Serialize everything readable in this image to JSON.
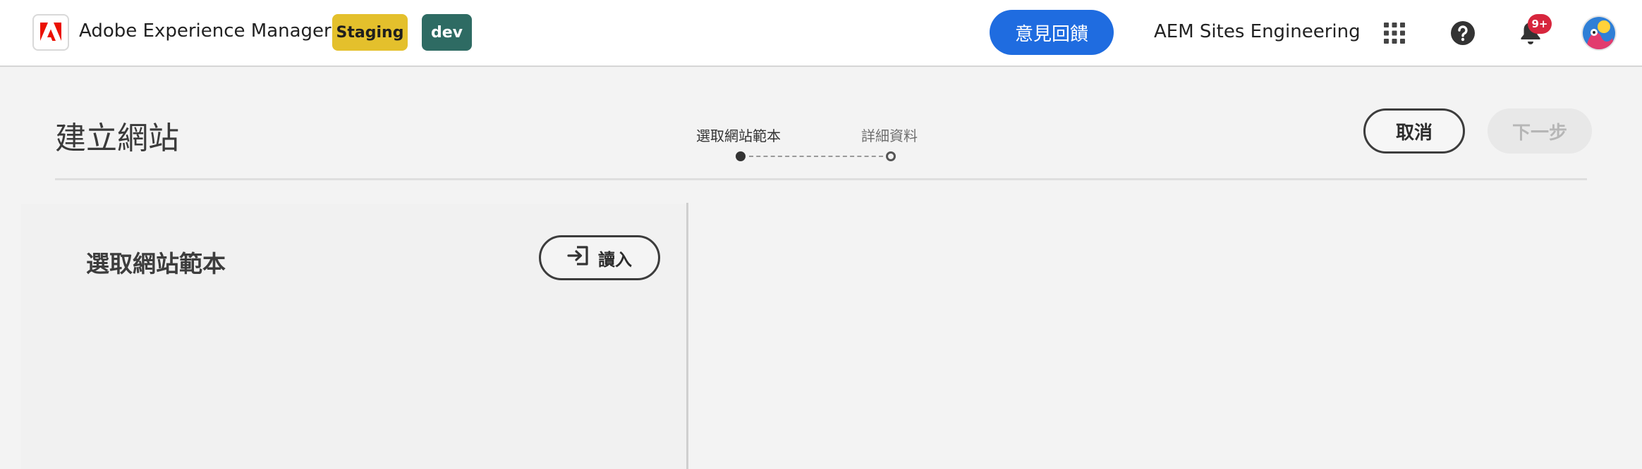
{
  "header": {
    "app_title": "Adobe Experience Manager",
    "logo_icon": "adobe-logo-icon",
    "env_badges": [
      {
        "label": "Staging",
        "color": "#e4c02c"
      },
      {
        "label": "dev",
        "color": "#2e6b63"
      }
    ],
    "feedback_label": "意見回饋",
    "org_name": "AEM Sites Engineering",
    "icons": [
      "apps-grid-icon",
      "help-icon",
      "bell-icon",
      "avatar"
    ],
    "notification_count": "9+",
    "accent_color": "#1f6ce0"
  },
  "wizard": {
    "title": "建立網站",
    "steps": [
      {
        "label": "選取網站範本",
        "state": "active"
      },
      {
        "label": "詳細資料",
        "state": "inactive"
      }
    ],
    "cancel_label": "取消",
    "next_label": "下一步"
  },
  "template_panel": {
    "title": "選取網站範本",
    "import_label": "讀入",
    "import_icon": "import-icon"
  }
}
